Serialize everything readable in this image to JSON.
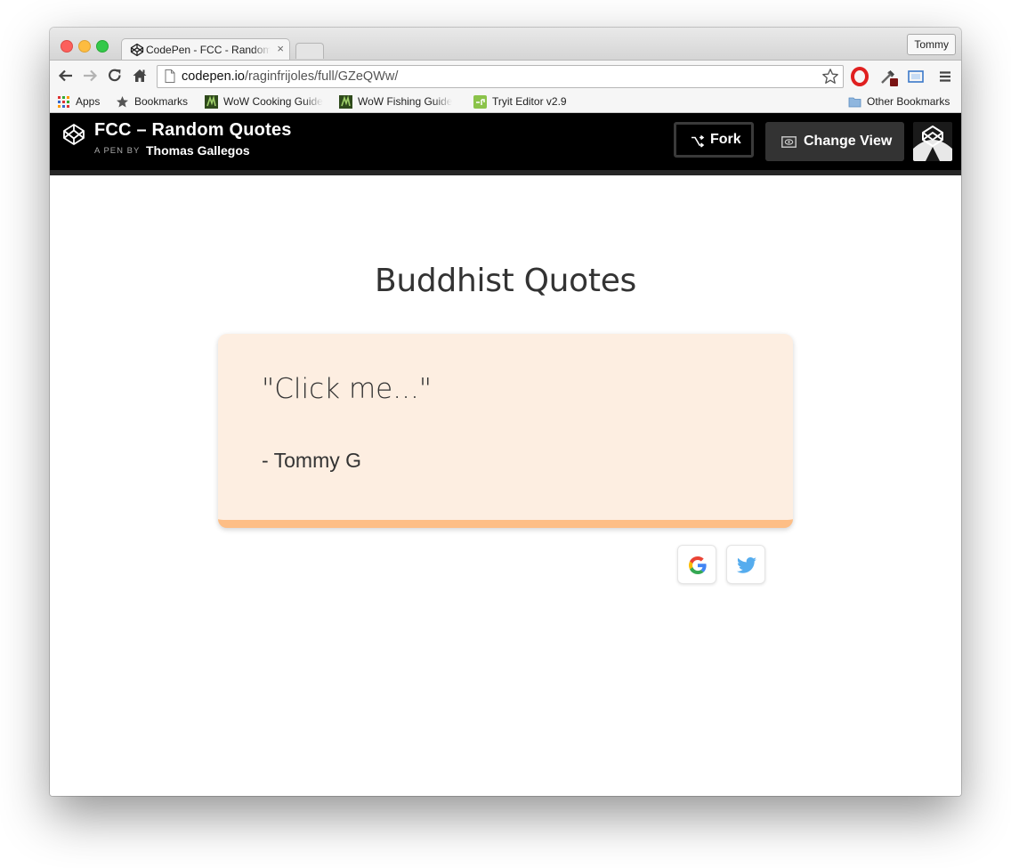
{
  "browser": {
    "tab_title": "CodePen - FCC - Random Quotes",
    "tab_close": "×",
    "profile": "Tommy",
    "url_host": "codepen.io",
    "url_path": "/raginfrijoles/full/GZeQWw/"
  },
  "bookmarks": {
    "items": [
      {
        "label": "Apps",
        "icon": "apps-grid-icon"
      },
      {
        "label": "Bookmarks",
        "icon": "star-icon"
      },
      {
        "label": "WoW Cooking Guide",
        "icon": "wow-icon"
      },
      {
        "label": "WoW Fishing Guide",
        "icon": "wow-icon"
      },
      {
        "label": "Tryit Editor v2.9",
        "icon": "tryit-icon"
      }
    ],
    "other": "Other Bookmarks"
  },
  "codepen": {
    "pen_title": "FCC – Random Quotes",
    "byline": "A PEN BY",
    "author": "Thomas Gallegos",
    "fork_label": "Fork",
    "change_view_label": "Change View"
  },
  "page": {
    "heading": "Buddhist Quotes",
    "quote": "\"Click me...\"",
    "author": "- Tommy G"
  },
  "colors": {
    "card_background": "#fdeee1",
    "card_border": "#fdbe86",
    "header_background": "#000000",
    "twitter_blue": "#55acee"
  }
}
